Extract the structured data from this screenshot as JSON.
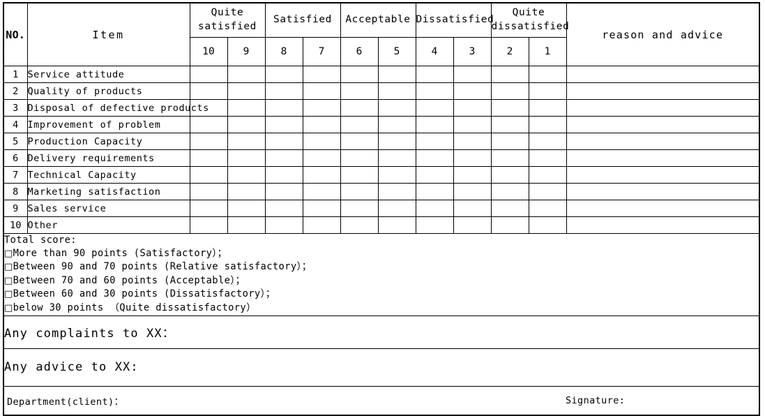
{
  "table": {
    "headers": {
      "no": "NO.",
      "item": "Item",
      "reason": "reason and advice"
    },
    "groups": [
      {
        "label": "Quite\nsatisfied",
        "label_line1": "Quite",
        "label_line2": "satisfied"
      },
      {
        "label": "Satisfied",
        "label_line1": "Satisfied",
        "label_line2": ""
      },
      {
        "label": "Acceptable",
        "label_line1": "Acceptable",
        "label_line2": ""
      },
      {
        "label": "Dissatisfied",
        "label_line1": "Dissatisfied",
        "label_line2": ""
      },
      {
        "label": "Quite\ndissatisfied",
        "label_line1": "Quite",
        "label_line2": "dissatisfied"
      }
    ],
    "scores": [
      "10",
      "9",
      "8",
      "7",
      "6",
      "5",
      "4",
      "3",
      "2",
      "1"
    ],
    "rows": [
      {
        "no": "1",
        "item": "Service attitude"
      },
      {
        "no": "2",
        "item": "Quality of products"
      },
      {
        "no": "3",
        "item": "Disposal of defective products"
      },
      {
        "no": "4",
        "item": "Improvement of problem"
      },
      {
        "no": "5",
        "item": "Production Capacity"
      },
      {
        "no": "6",
        "item": "Delivery requirements"
      },
      {
        "no": "7",
        "item": "Technical Capacity"
      },
      {
        "no": "8",
        "item": "Marketing satisfaction"
      },
      {
        "no": "9",
        "item": "Sales service"
      },
      {
        "no": "10",
        "item": "Other"
      }
    ]
  },
  "total_score": {
    "title": "Total score:",
    "checkbox_glyph": "□",
    "options": [
      "More than 90 points (Satisfactory）；",
      "Between 90 and 70 points (Relative satisfactory）；",
      "Between 70 and 60 points (Acceptable）；",
      "Between 60 and 30 points (Dissatisfactory）；",
      "below 30 points （Quite dissatisfactory）"
    ]
  },
  "complaints": {
    "label": "Any complaints to XX："
  },
  "advice": {
    "label": "Any advice to XX:"
  },
  "signature_row": {
    "department_label": "Department(client)：",
    "signature_label": "Signature:"
  }
}
